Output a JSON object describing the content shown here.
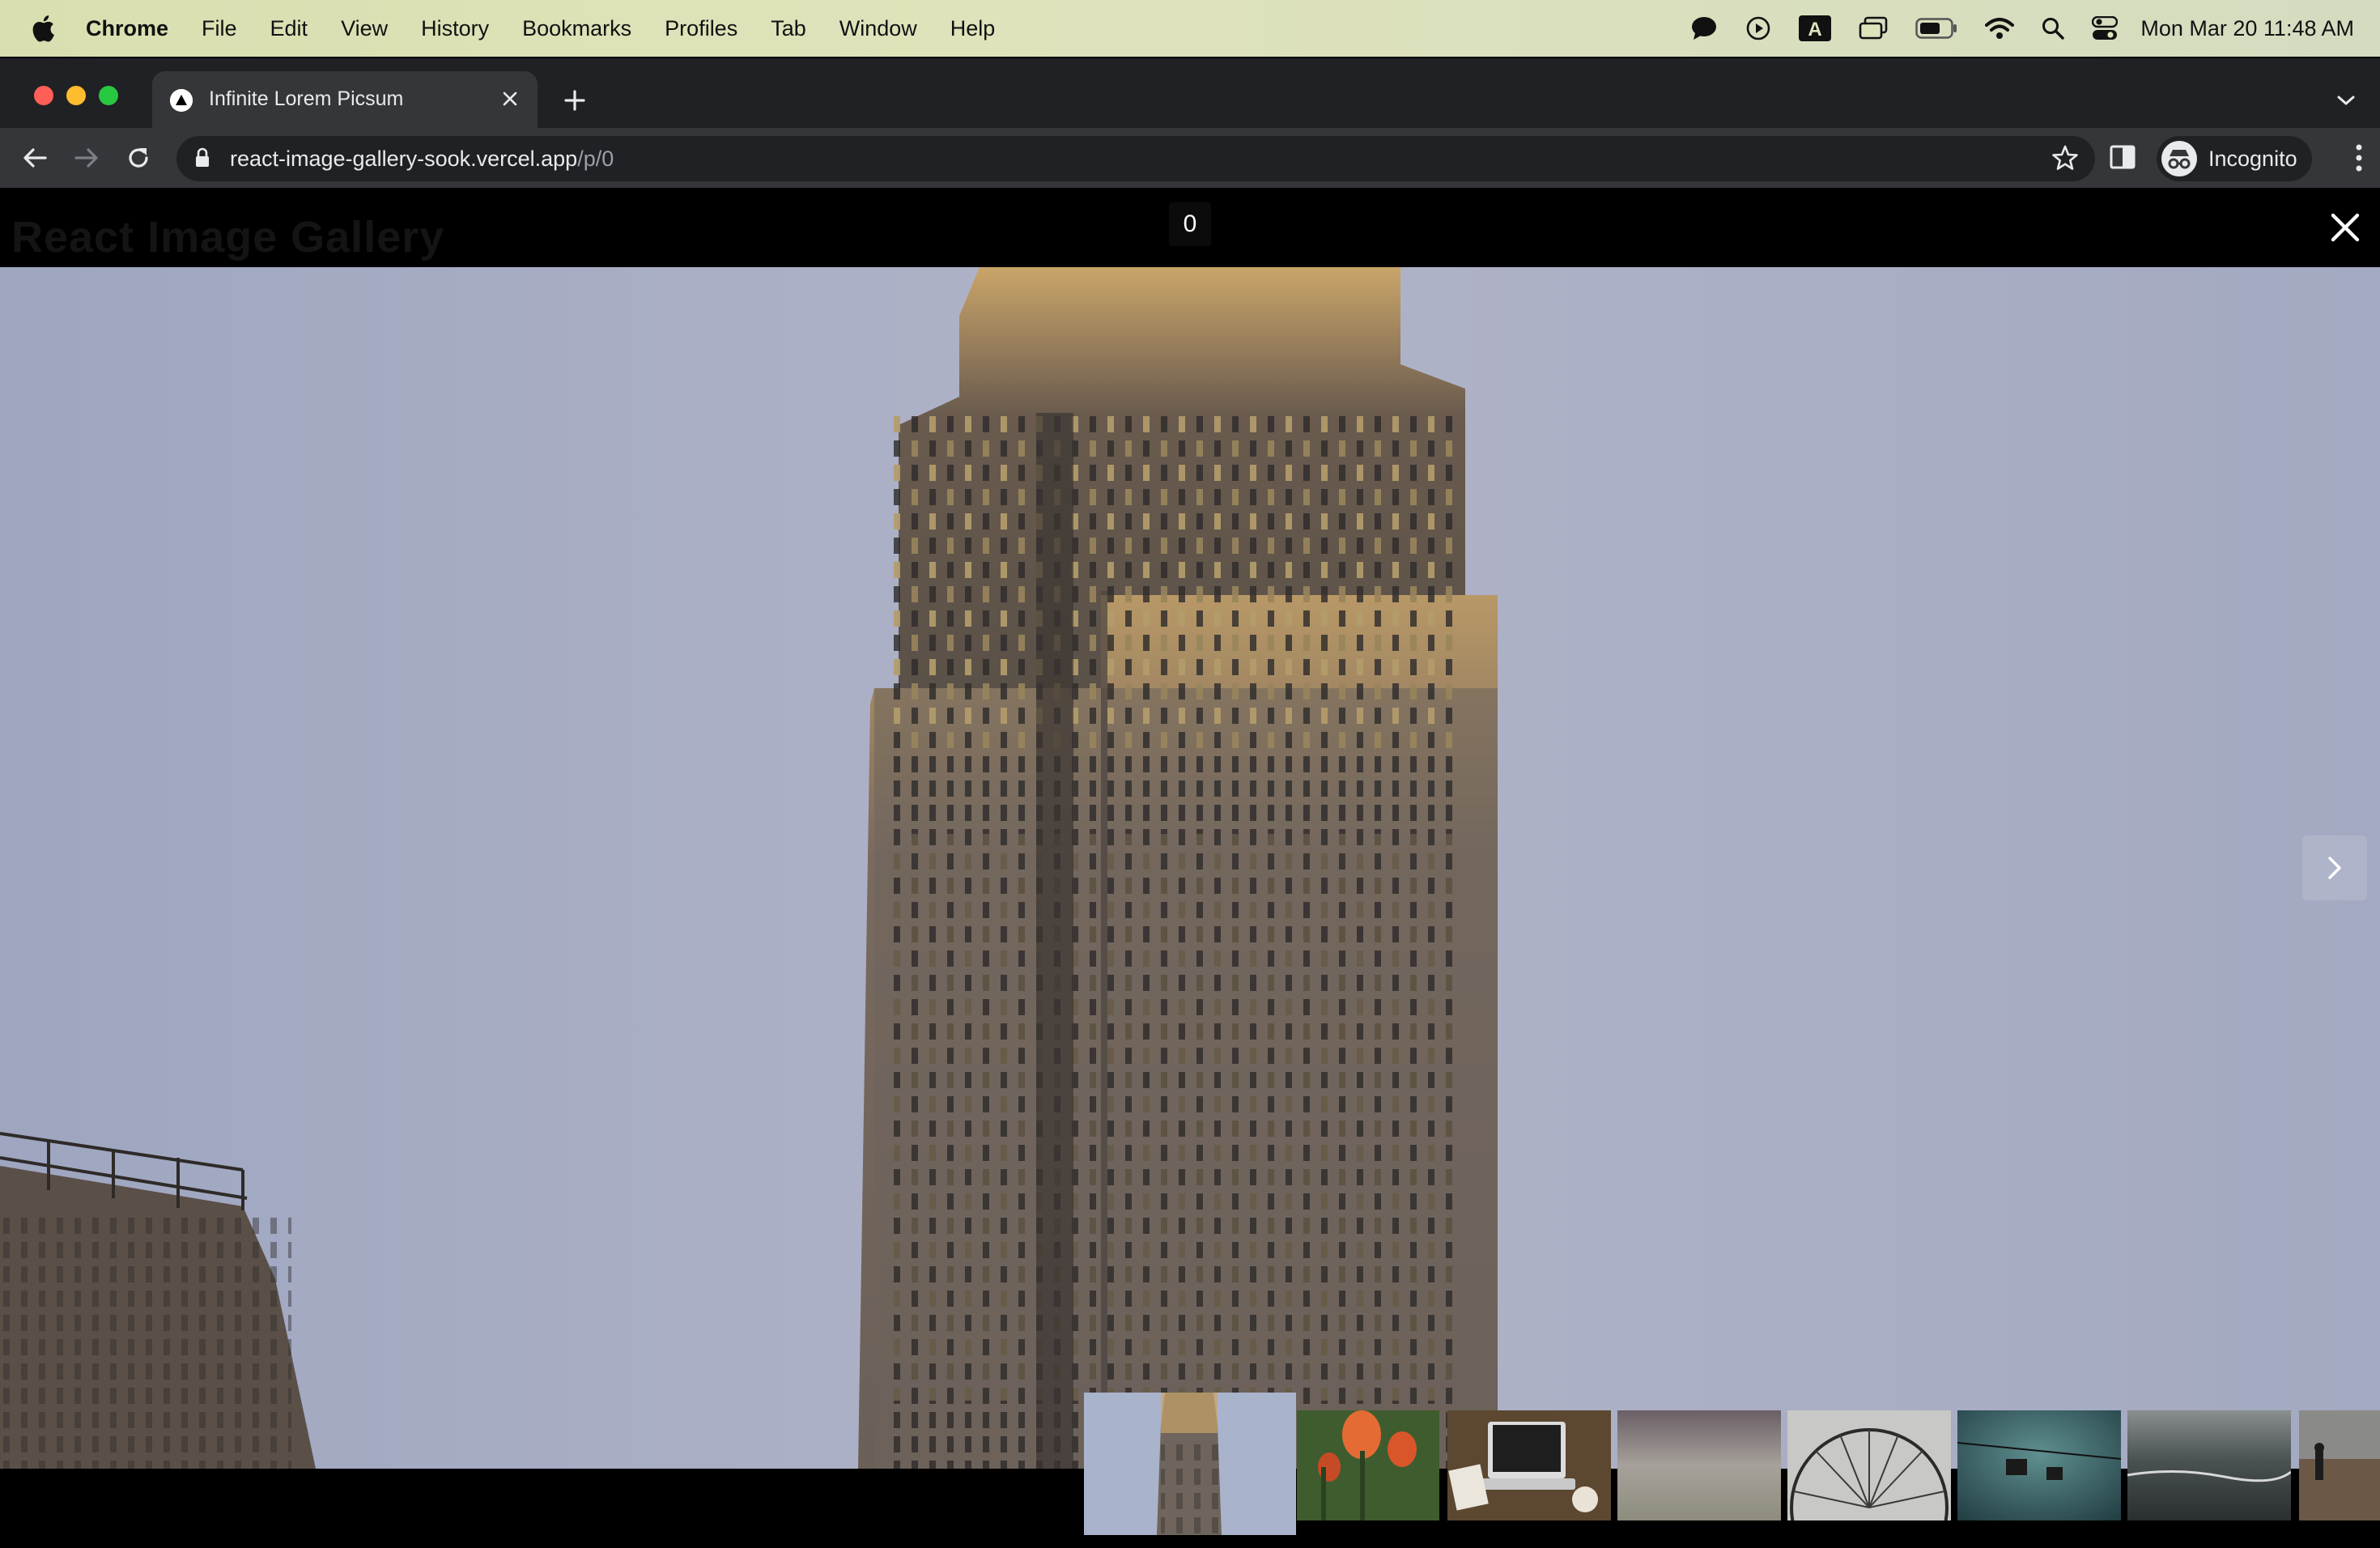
{
  "menubar": {
    "app_name": "Chrome",
    "menus": [
      "File",
      "Edit",
      "View",
      "History",
      "Bookmarks",
      "Profiles",
      "Tab",
      "Window",
      "Help"
    ],
    "status_icons": [
      "messages-icon",
      "play-icon",
      "keyboard-input-icon",
      "screen-mirroring-icon",
      "battery-icon",
      "wifi-icon",
      "spotlight-search-icon",
      "control-center-icon"
    ],
    "clock": "Mon Mar 20  11:48 AM"
  },
  "browser": {
    "tab": {
      "title": "Infinite Lorem Picsum"
    },
    "address": {
      "host": "react-image-gallery-sook.vercel.app",
      "path": "/p/0"
    },
    "profile_label": "Incognito"
  },
  "page": {
    "heading": "React Image Gallery",
    "counter": "0",
    "thumbnails": [
      {
        "name": "empire-state-building"
      },
      {
        "name": "tulips"
      },
      {
        "name": "laptop-on-desk"
      },
      {
        "name": "misty-field"
      },
      {
        "name": "ferris-wheel"
      },
      {
        "name": "cable-car"
      },
      {
        "name": "ocean-shore"
      },
      {
        "name": "person-on-beach"
      }
    ]
  },
  "colors": {
    "accent_red": "#ff5f57",
    "accent_yellow": "#febc2e",
    "accent_green": "#28c840",
    "chrome_dark": "#202124",
    "chrome_toolbar": "#35363a"
  }
}
